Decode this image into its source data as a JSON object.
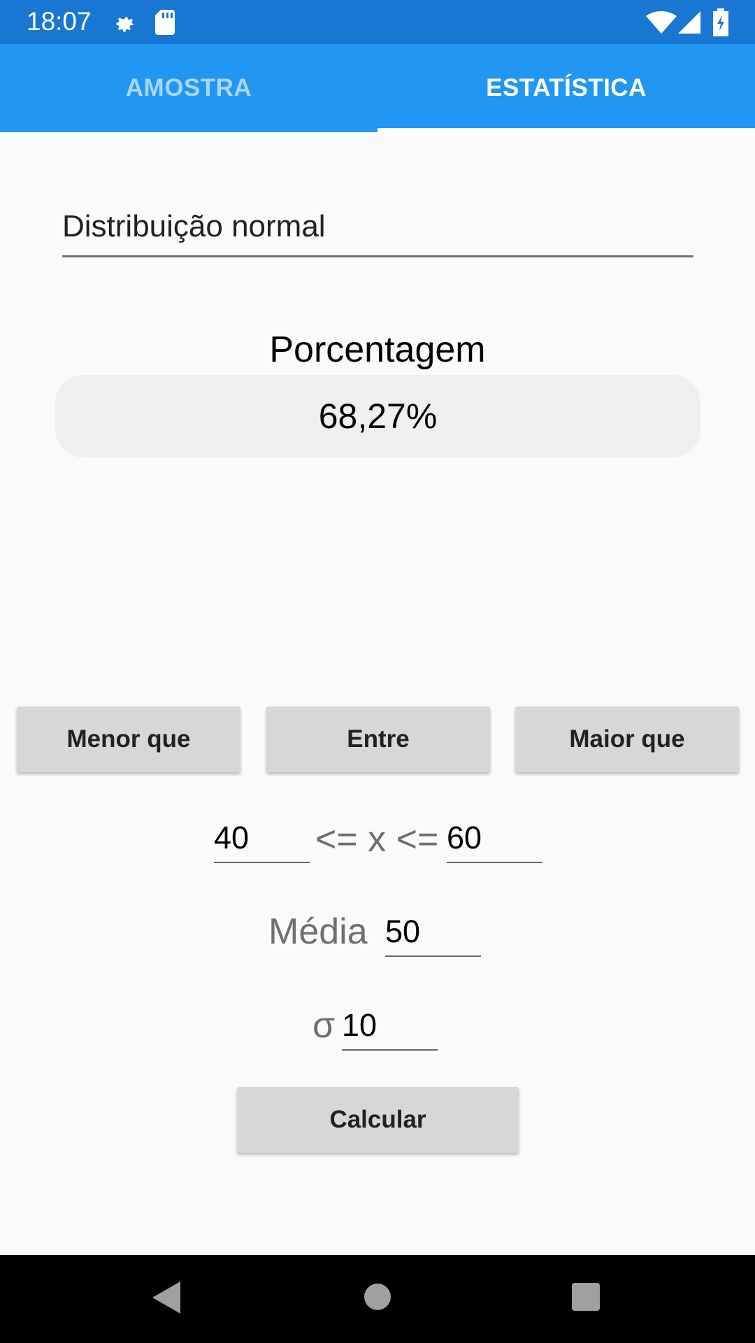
{
  "status_bar": {
    "time": "18:07",
    "icons": [
      "gear-icon",
      "sd-card-icon",
      "wifi-icon",
      "signal-icon",
      "battery-icon"
    ]
  },
  "tabs": [
    {
      "label": "AMOSTRA",
      "selected": false
    },
    {
      "label": "ESTATÍSTICA",
      "selected": true
    }
  ],
  "distribution": {
    "selected": "Distribuição normal"
  },
  "result": {
    "label": "Porcentagem",
    "value": "68,27%"
  },
  "modes": {
    "less": "Menor que",
    "between": "Entre",
    "greater": "Maior que"
  },
  "range": {
    "lower": "40",
    "operator": "<= x <=",
    "upper": "60"
  },
  "mean": {
    "label": "Média",
    "value": "50"
  },
  "sigma": {
    "label": "σ",
    "value": "10"
  },
  "calculate_label": "Calcular",
  "colors": {
    "status_bar": "#1976d2",
    "tab_bar": "#2196f3",
    "button": "#d6d7d7",
    "result_box": "#efefef"
  }
}
